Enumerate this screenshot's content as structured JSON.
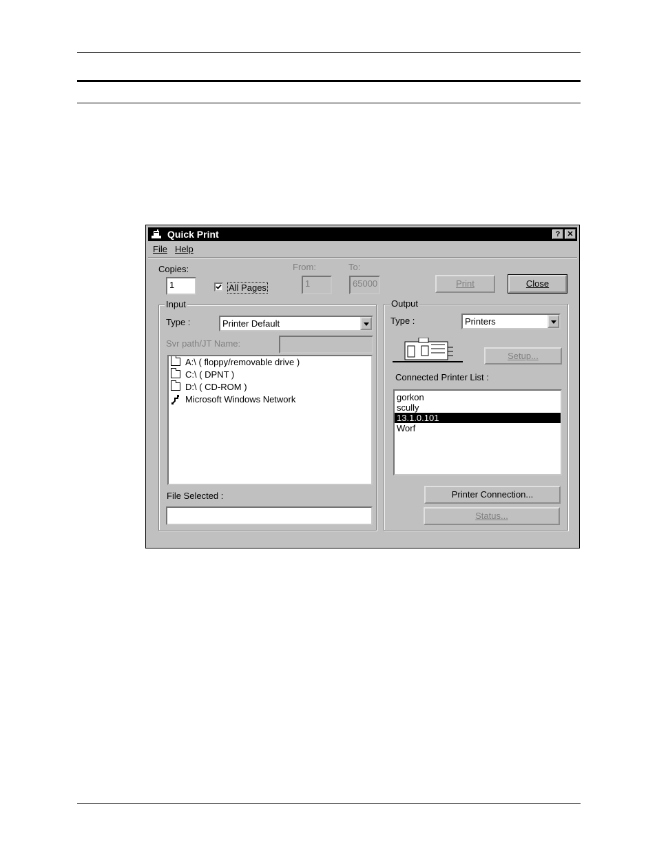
{
  "window": {
    "title": "Quick Print",
    "help_btn": "?",
    "close_btn": "✕"
  },
  "menu": {
    "file": "File",
    "help": "Help"
  },
  "copies": {
    "label": "Copies:",
    "value": "1"
  },
  "all_pages": {
    "label": "All Pages",
    "checked": true
  },
  "range": {
    "from_label": "From:",
    "from_value": "1",
    "to_label": "To:",
    "to_value": "65000"
  },
  "buttons": {
    "print": "Print",
    "close": "Close",
    "setup": "Setup...",
    "printer_connection": "Printer Connection...",
    "status": "Status..."
  },
  "input": {
    "group_title": "Input",
    "type_label": "Type :",
    "type_value": "Printer Default",
    "svr_label": "Svr path/JT Name:",
    "svr_value": "",
    "drives": [
      {
        "label": "A:\\ ( floppy/removable drive )",
        "icon": "folder-icon"
      },
      {
        "label": "C:\\ ( DPNT )",
        "icon": "folder-icon"
      },
      {
        "label": "D:\\ ( CD-ROM )",
        "icon": "folder-icon"
      },
      {
        "label": "Microsoft Windows Network",
        "icon": "network-icon"
      }
    ],
    "file_selected_label": "File Selected :",
    "file_selected_value": ""
  },
  "output": {
    "group_title": "Output",
    "type_label": "Type :",
    "type_value": "Printers",
    "printer_list_label": "Connected Printer List :",
    "printers": [
      "gorkon",
      "scully",
      "13.1.0.101",
      "Worf"
    ],
    "selected_printer": "13.1.0.101"
  }
}
